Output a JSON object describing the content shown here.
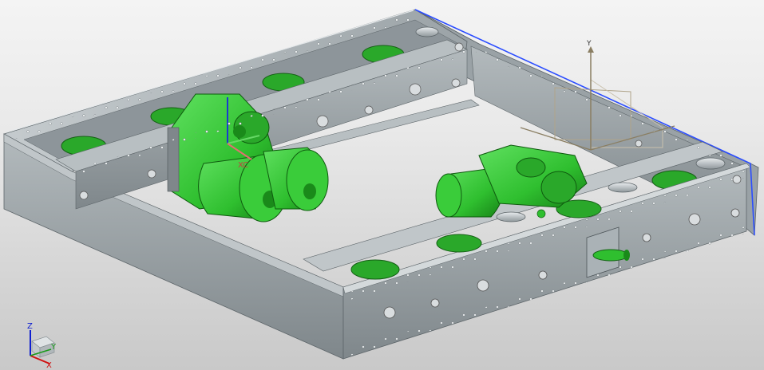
{
  "viewport": {
    "background_top": "#f4f4f4",
    "background_bottom": "#c9c9c9"
  },
  "colors": {
    "frame": "#8e969a",
    "frame_light": "#aab2b6",
    "frame_dark": "#6f777b",
    "motor_green": "#2fbf2f",
    "motor_dark": "#1a8a1a",
    "selection_blue": "#2b4dff",
    "datum_tan": "#b0a48a"
  },
  "datum_csys": {
    "y_label": "Y"
  },
  "motor_csys": {
    "x_label": "XC"
  },
  "view_triad": {
    "x_label": "X",
    "y_label": "Y",
    "z_label": "Z",
    "x_color": "#d01010",
    "y_color": "#1a9a1a",
    "z_color": "#1020d0"
  }
}
